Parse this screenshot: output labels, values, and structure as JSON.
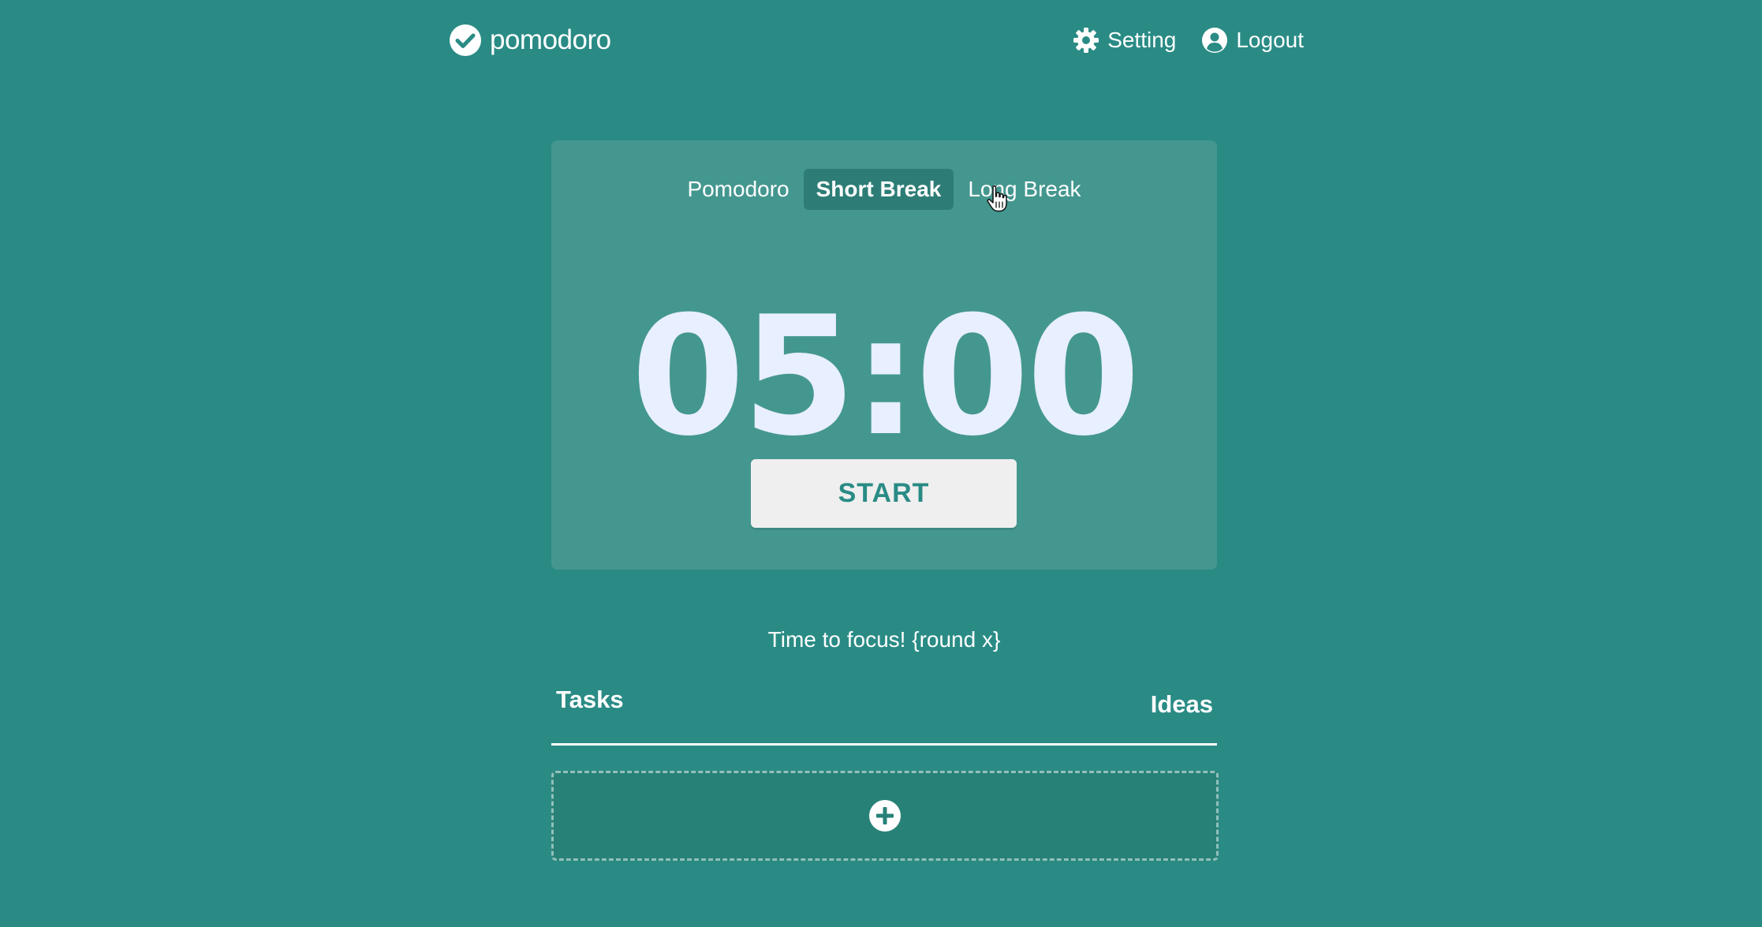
{
  "header": {
    "brand": "pomodoro",
    "logo_icon": "check-circle-icon",
    "nav": [
      {
        "label": "Setting",
        "icon": "gear-icon"
      },
      {
        "label": "Logout",
        "icon": "user-circle-icon"
      }
    ]
  },
  "timer": {
    "modes": [
      {
        "label": "Pomodoro",
        "active": false
      },
      {
        "label": "Short Break",
        "active": true
      },
      {
        "label": "Long Break",
        "active": false
      }
    ],
    "time": "05:00",
    "start_label": "START"
  },
  "message": "Time to focus! {round x}",
  "tabs": {
    "tasks": "Tasks",
    "ideas": "Ideas"
  },
  "add_task": {
    "icon": "plus-circle-icon"
  },
  "colors": {
    "background": "#2a8b85",
    "card": "#44978f",
    "active_mode": "#2d7d76",
    "timer_text": "#e8efff",
    "button": "#efefef"
  }
}
